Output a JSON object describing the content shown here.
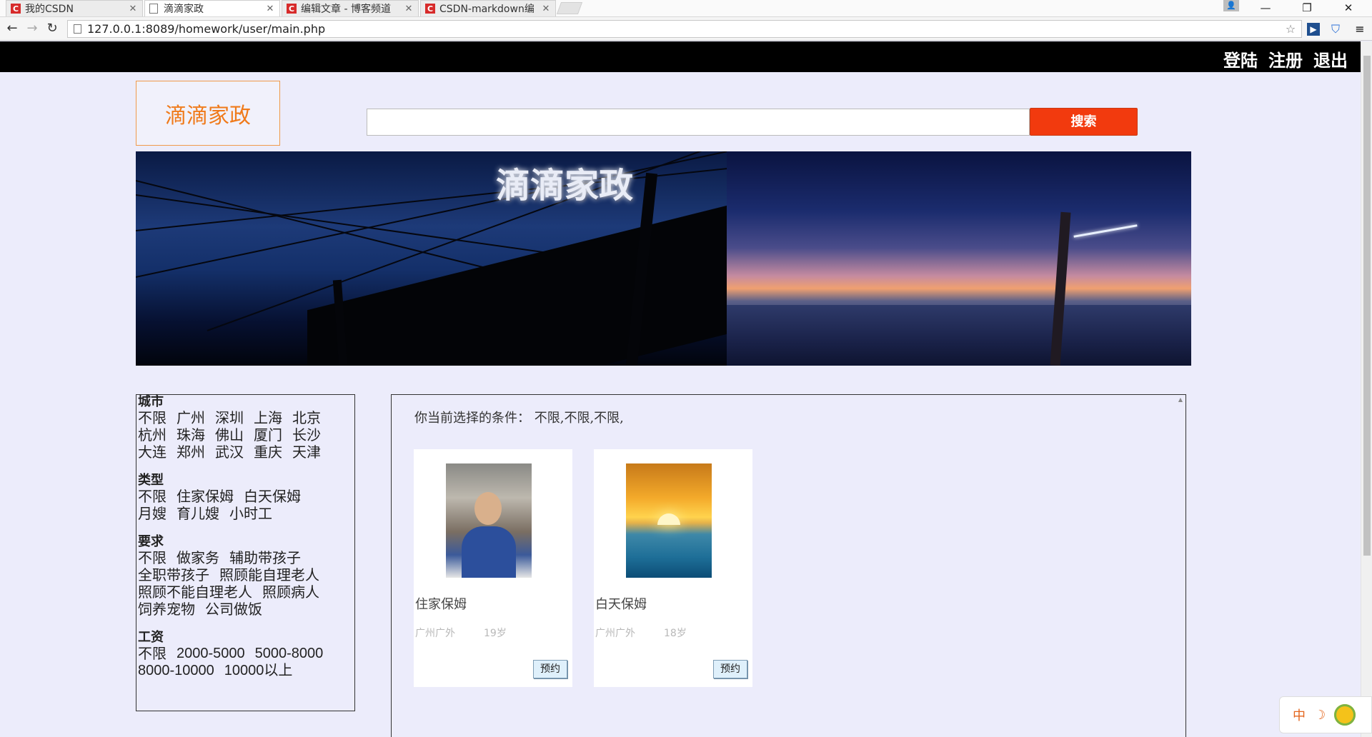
{
  "browser": {
    "tabs": [
      {
        "title": "我的CSDN",
        "icon": "csdn-icon",
        "active": false
      },
      {
        "title": "滴滴家政",
        "icon": "page-icon",
        "active": true
      },
      {
        "title": "编辑文章 - 博客频道",
        "icon": "csdn-icon",
        "active": false
      },
      {
        "title": "CSDN-markdown编",
        "icon": "csdn-icon",
        "active": false
      }
    ],
    "url": "127.0.0.1:8089/homework/user/main.php",
    "window_controls": {
      "minimize": "—",
      "restore": "❐",
      "close": "✕"
    }
  },
  "topnav": {
    "login": "登陆",
    "register": "注册",
    "logout": "退出"
  },
  "logo": "滴滴家政",
  "search": {
    "placeholder": "",
    "value": "",
    "button": "搜索"
  },
  "banner": {
    "title": "滴滴家政"
  },
  "filters": {
    "city": {
      "heading": "城市",
      "rows": [
        [
          "不限",
          "广州",
          "深圳",
          "上海",
          "北京"
        ],
        [
          "杭州",
          "珠海",
          "佛山",
          "厦门",
          "长沙"
        ],
        [
          "大连",
          "郑州",
          "武汉",
          "重庆",
          "天津"
        ]
      ]
    },
    "type": {
      "heading": "类型",
      "rows": [
        [
          "不限",
          "住家保姆",
          "白天保姆"
        ],
        [
          "月嫂",
          "育儿嫂",
          "小时工"
        ]
      ]
    },
    "requirement": {
      "heading": "要求",
      "rows": [
        [
          "不限",
          "做家务",
          "辅助带孩子"
        ],
        [
          "全职带孩子",
          "照顾能自理老人"
        ],
        [
          "照顾不能自理老人",
          "照顾病人"
        ],
        [
          "饲养宠物",
          "公司做饭"
        ]
      ]
    },
    "salary": {
      "heading": "工资",
      "rows": [
        [
          "不限",
          "2000-5000",
          "5000-8000"
        ],
        [
          "8000-10000",
          "10000以上"
        ]
      ]
    }
  },
  "results": {
    "criteria_label": "你当前选择的条件：",
    "criteria_value": "不限,不限,不限,",
    "cards": [
      {
        "title": "住家保姆",
        "location": "广州广外",
        "age": "19岁",
        "book": "预约"
      },
      {
        "title": "白天保姆",
        "location": "广州广外",
        "age": "18岁",
        "book": "预约"
      }
    ]
  },
  "ime": {
    "mode": "中"
  },
  "colors": {
    "page_bg": "#ececfb",
    "topnav_bg": "#000000",
    "accent_orange": "#f07a1a",
    "search_button": "#f23a0e"
  }
}
